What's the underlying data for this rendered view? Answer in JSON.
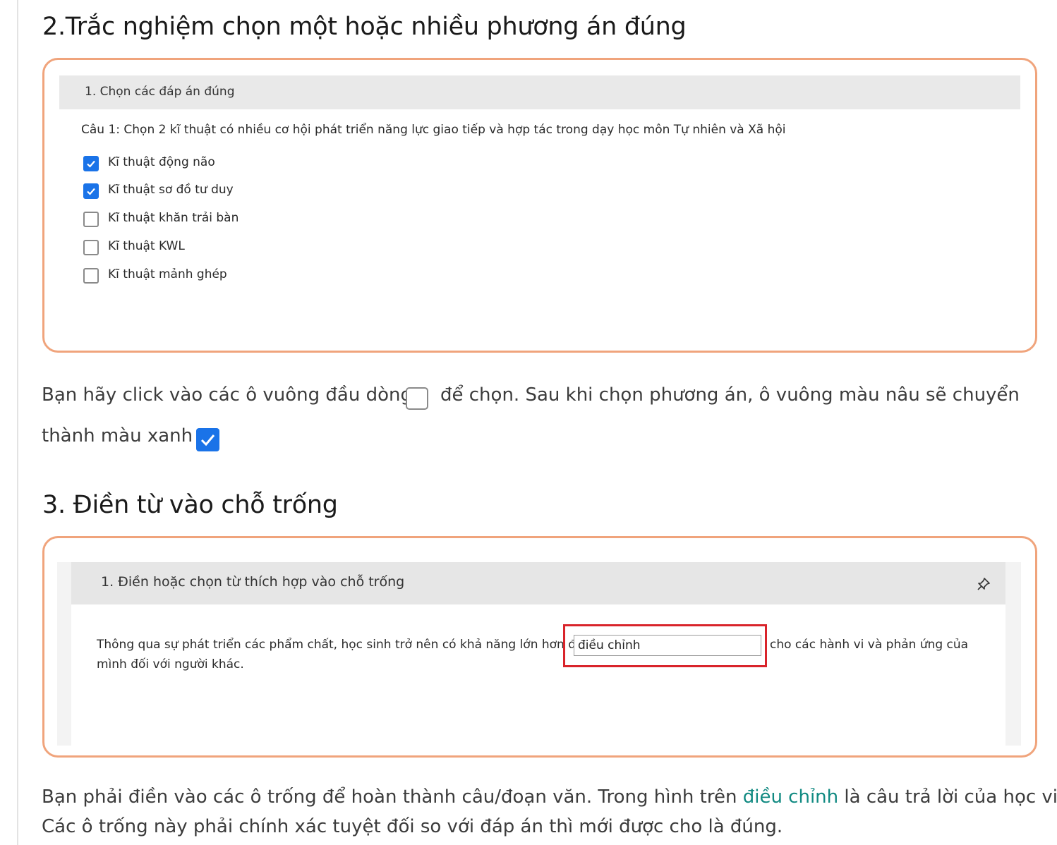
{
  "section2": {
    "heading": "2.Trắc nghiệm chọn một hoặc nhiều phương án đúng",
    "quiz": {
      "header": "1. Chọn các đáp án đúng",
      "question": "Câu 1: Chọn 2 kĩ thuật có nhiều cơ hội phát triển năng lực giao tiếp và hợp tác trong dạy học môn Tự nhiên và Xã hội",
      "options": [
        {
          "label": "Kĩ thuật động não",
          "checked": true
        },
        {
          "label": "Kĩ thuật sơ đồ tư duy",
          "checked": true
        },
        {
          "label": "Kĩ thuật khăn trải bàn",
          "checked": false
        },
        {
          "label": "Kĩ thuật KWL",
          "checked": false
        },
        {
          "label": "Kĩ thuật mảnh ghép",
          "checked": false
        }
      ]
    },
    "instruction_line1_before": "Bạn hãy click vào các ô vuông đầu dòng",
    "instruction_line1_after": "để chọn. Sau khi chọn phương án, ô vuông màu nâu sẽ chuyển",
    "instruction_line2": "thành màu xanh"
  },
  "section3": {
    "heading": "3. Điền từ vào chỗ trống",
    "quiz": {
      "header": "1. Điền hoặc chọn từ thích hợp vào chỗ trống",
      "text_before": "Thông qua sự phát triển các phẩm chất, học sinh trở nên có khả năng lớn hơn để",
      "answer_value": "điều chỉnh",
      "text_after": "cho các hành vi và phản ứng của",
      "text_line2": "mình đối với người khác."
    },
    "explanation_line1_before": "Bạn phải điền vào các ô trống để hoàn thành câu/đoạn văn. Trong hình trên",
    "explanation_highlight": "điều chỉnh",
    "explanation_line1_after": "là câu trả lời của học viên.",
    "explanation_line2": "Các ô trống này phải chính xác tuyệt đối so với đáp án thì mới được cho là đúng."
  },
  "colors": {
    "frame_border": "#f0a47c",
    "checkbox_checked": "#1a73e8",
    "highlight_text": "#118a82",
    "answer_box_border": "#d9242b"
  }
}
